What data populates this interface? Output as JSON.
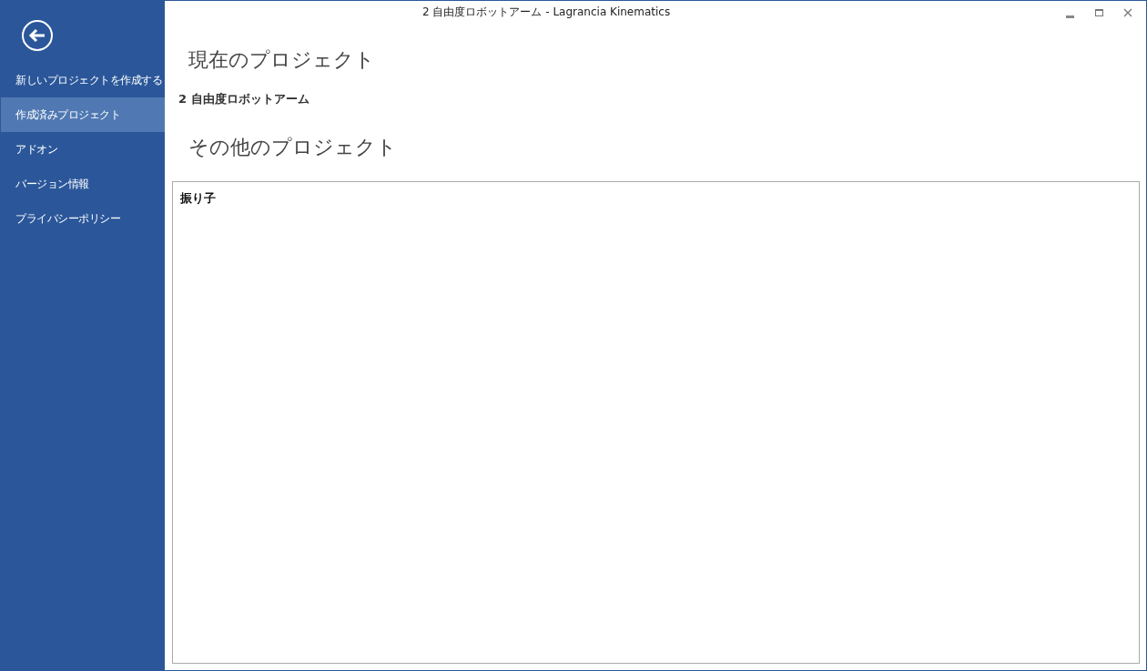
{
  "window": {
    "title": "2 自由度ロボットアーム - Lagrancia Kinematics"
  },
  "sidebar": {
    "items": [
      {
        "label": "新しいプロジェクトを作成する",
        "selected": false
      },
      {
        "label": "作成済みプロジェクト",
        "selected": true
      },
      {
        "label": "アドオン",
        "selected": false
      },
      {
        "label": "バージョン情報",
        "selected": false
      },
      {
        "label": "プライバシーポリシー",
        "selected": false
      }
    ]
  },
  "current": {
    "heading": "現在のプロジェクト",
    "project": "2 自由度ロボットアーム"
  },
  "other": {
    "heading": "その他のプロジェクト",
    "projects": [
      "振り子"
    ]
  }
}
